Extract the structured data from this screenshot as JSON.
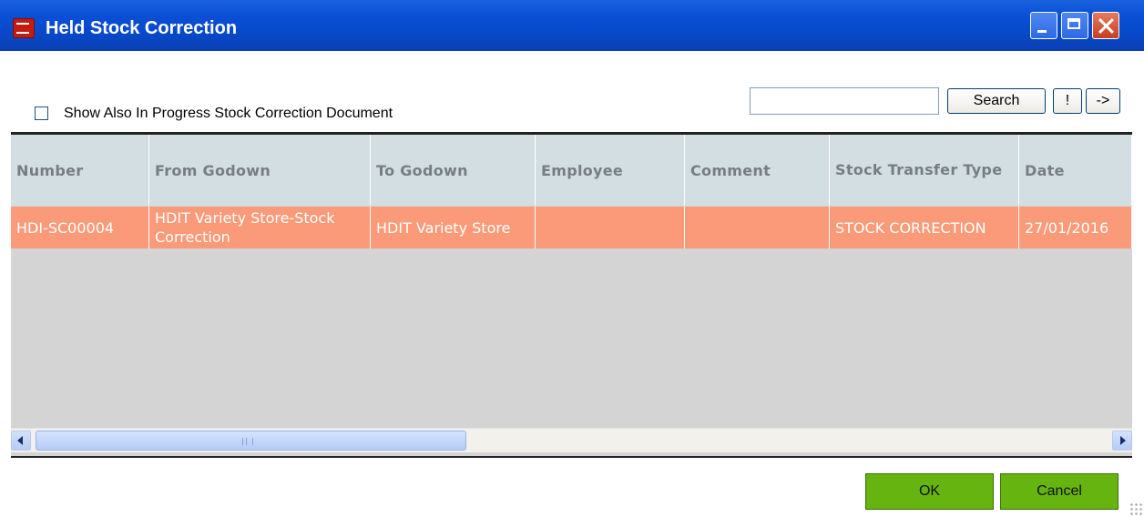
{
  "window": {
    "title": "Held Stock Correction"
  },
  "filter": {
    "show_in_progress_label": "Show Also In Progress Stock Correction Document",
    "show_in_progress_checked": false
  },
  "search": {
    "value": "",
    "search_label": "Search",
    "exclaim_label": "!",
    "arrow_label": "->"
  },
  "table": {
    "headers": {
      "number": "Number",
      "from_godown": "From Godown",
      "to_godown": "To Godown",
      "employee": "Employee",
      "comment": "Comment",
      "stock_transfer_type": "Stock Transfer Type",
      "date": "Date"
    },
    "rows": [
      {
        "number": "HDI-SC00004",
        "from_godown": "HDIT Variety Store-Stock Correction",
        "to_godown": "HDIT Variety Store",
        "employee": "",
        "comment": "",
        "stock_transfer_type": "STOCK CORRECTION",
        "date": "27/01/2016"
      }
    ],
    "scroll_grip": "IIII"
  },
  "footer": {
    "ok_label": "OK",
    "cancel_label": "Cancel"
  },
  "colors": {
    "titlebar": "#0a4fd6",
    "header_bg": "#d2dee2",
    "selected_row": "#fb9a79",
    "grid_bg": "#d4d4d4",
    "action_button": "#65b40f"
  },
  "icons": [
    "cart-icon",
    "minimize-icon",
    "maximize-icon",
    "close-icon",
    "scroll-left-icon",
    "scroll-right-icon",
    "resize-grip-icon"
  ]
}
